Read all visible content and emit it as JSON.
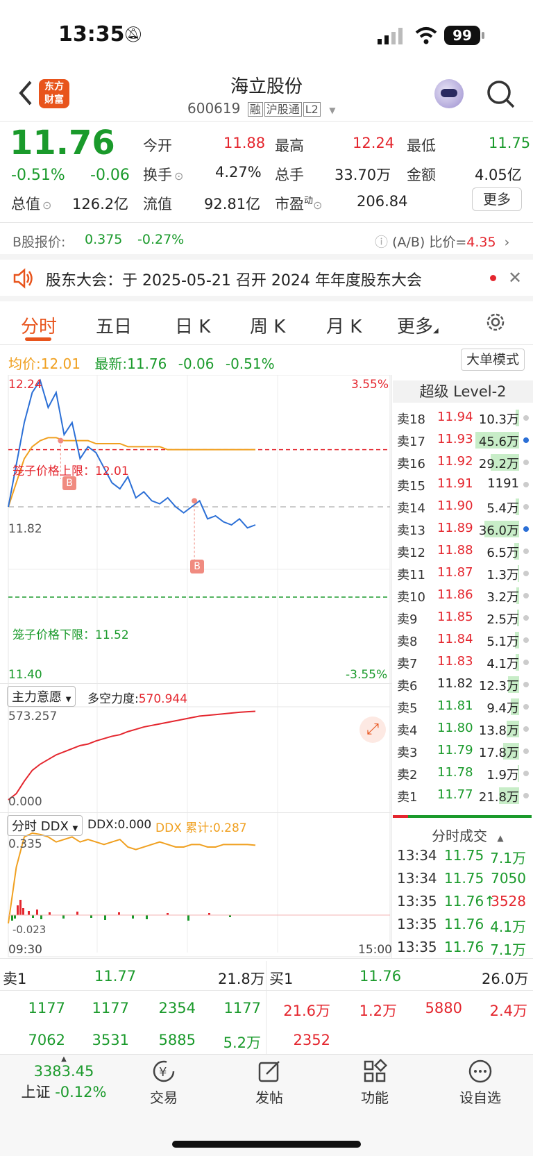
{
  "status": {
    "time": "13:35",
    "battery": "99"
  },
  "header": {
    "title": "海立股份",
    "code": "600619",
    "badges": [
      "融",
      "沪股通",
      "L2"
    ],
    "logo_line1": "东方",
    "logo_line2": "财富"
  },
  "quote": {
    "price": "11.76",
    "pct": "-0.51%",
    "chg": "-0.06",
    "open_label": "今开",
    "open": "11.88",
    "high_label": "最高",
    "high": "12.24",
    "low_label": "最低",
    "low": "11.75",
    "turnover_label": "换手",
    "turnover": "4.27%",
    "volume_label": "总手",
    "volume": "33.70万",
    "amount_label": "金额",
    "amount": "4.05亿",
    "mcap_label": "总值",
    "mcap": "126.2亿",
    "float_label": "流值",
    "float": "92.81亿",
    "pe_label": "市盈",
    "pe_sup": "动",
    "pe": "206.84",
    "more": "更多"
  },
  "bshare": {
    "label": "B股报价:",
    "price": "0.375",
    "pct": "-0.27%",
    "ratio_label": "(A/B) 比价=",
    "ratio": "4.35"
  },
  "notice": {
    "text": "股东大会：于 2025-05-21 召开 2024 年年度股东大会"
  },
  "tabs": [
    "分时",
    "五日",
    "日 K",
    "周 K",
    "月 K",
    "更多"
  ],
  "avg_line": {
    "avg_label": "均价:",
    "avg": "12.01",
    "latest_label": "最新:",
    "latest": "11.76",
    "chg": "-0.06",
    "pct": "-0.51%",
    "mode_btn": "大单模式"
  },
  "chart": {
    "top_price": "12.24",
    "top_pct": "3.55%",
    "mid_price": "11.82",
    "bottom_price": "11.40",
    "bottom_pct": "-3.55%",
    "upper_limit": "笼子价格上限：12.01",
    "lower_limit": "笼子价格下限：11.52",
    "marker": "B",
    "ind1_name": "主力意愿",
    "ind1_label": "多空力度:",
    "ind1_value": "570.944",
    "ind1_max": "573.257",
    "ind1_min": "0.000",
    "ind2_name": "分时 DDX",
    "ind2_ddx": "DDX:0.000",
    "ind2_cum": "DDX 累计:0.287",
    "ind2_max": "0.335",
    "ind2_min": "-0.023",
    "time_start": "09:30",
    "time_end": "15:00"
  },
  "chart_data": {
    "type": "line",
    "ylim": [
      11.4,
      12.24
    ],
    "open": 11.82,
    "upper_limit": 12.01,
    "lower_limit": 11.52,
    "price": [
      11.82,
      11.96,
      12.1,
      12.2,
      12.24,
      12.15,
      12.2,
      12.06,
      12.1,
      11.98,
      12.02,
      12.0,
      11.95,
      11.9,
      11.88,
      11.92,
      11.85,
      11.87,
      11.84,
      11.83,
      11.85,
      11.82,
      11.8,
      11.82,
      11.84,
      11.78,
      11.79,
      11.77,
      11.76,
      11.78,
      11.75,
      11.76
    ],
    "avg": [
      11.82,
      11.9,
      11.98,
      12.02,
      12.04,
      12.05,
      12.05,
      12.04,
      12.04,
      12.04,
      12.04,
      12.03,
      12.03,
      12.03,
      12.03,
      12.02,
      12.02,
      12.02,
      12.02,
      12.02,
      12.01,
      12.01,
      12.01,
      12.01,
      12.01,
      12.01,
      12.01,
      12.01,
      12.01,
      12.01,
      12.01,
      12.01
    ],
    "force": [
      0,
      40,
      120,
      190,
      230,
      260,
      290,
      310,
      330,
      350,
      360,
      380,
      395,
      410,
      420,
      440,
      455,
      470,
      480,
      490,
      500,
      510,
      520,
      530,
      540,
      545,
      550,
      555,
      560,
      565,
      568,
      570.944
    ],
    "ddx": [
      -0.023,
      0.2,
      0.32,
      0.335,
      0.33,
      0.32,
      0.3,
      0.31,
      0.32,
      0.3,
      0.31,
      0.3,
      0.29,
      0.3,
      0.31,
      0.28,
      0.27,
      0.28,
      0.29,
      0.3,
      0.29,
      0.28,
      0.28,
      0.29,
      0.29,
      0.28,
      0.28,
      0.29,
      0.29,
      0.29,
      0.29,
      0.287
    ]
  },
  "level2": {
    "title": "超级 Level-2",
    "sells": [
      {
        "label": "卖18",
        "price": "11.94",
        "vol": "10.3万",
        "bar": 0.05,
        "color": "#e4262e",
        "dot": "#ccc"
      },
      {
        "label": "卖17",
        "price": "11.93",
        "vol": "45.6万",
        "bar": 0.7,
        "color": "#e4262e",
        "dot": "#2b6fd6"
      },
      {
        "label": "卖16",
        "price": "11.92",
        "vol": "29.2万",
        "bar": 0.45,
        "color": "#e4262e",
        "dot": "#ccc"
      },
      {
        "label": "卖15",
        "price": "11.91",
        "vol": "1191",
        "bar": 0,
        "color": "#e4262e",
        "dot": "#ccc"
      },
      {
        "label": "卖14",
        "price": "11.90",
        "vol": "5.4万",
        "bar": 0.05,
        "color": "#e4262e",
        "dot": "#ccc"
      },
      {
        "label": "卖13",
        "price": "11.89",
        "vol": "36.0万",
        "bar": 0.55,
        "color": "#e4262e",
        "dot": "#2b6fd6"
      },
      {
        "label": "卖12",
        "price": "11.88",
        "vol": "6.5万",
        "bar": 0.08,
        "color": "#e4262e",
        "dot": "#ccc"
      },
      {
        "label": "卖11",
        "price": "11.87",
        "vol": "1.3万",
        "bar": 0.02,
        "color": "#e4262e",
        "dot": "#ccc"
      },
      {
        "label": "卖10",
        "price": "11.86",
        "vol": "3.2万",
        "bar": 0.04,
        "color": "#e4262e",
        "dot": "#ccc"
      },
      {
        "label": "卖9",
        "price": "11.85",
        "vol": "2.5万",
        "bar": 0.03,
        "color": "#e4262e",
        "dot": "#ccc"
      },
      {
        "label": "卖8",
        "price": "11.84",
        "vol": "5.1万",
        "bar": 0.07,
        "color": "#e4262e",
        "dot": "#ccc"
      },
      {
        "label": "卖7",
        "price": "11.83",
        "vol": "4.1万",
        "bar": 0.06,
        "color": "#e4262e",
        "dot": "#ccc"
      },
      {
        "label": "卖6",
        "price": "11.82",
        "vol": "12.3万",
        "bar": 0.18,
        "color": "#222",
        "dot": "#ccc"
      },
      {
        "label": "卖5",
        "price": "11.81",
        "vol": "9.4万",
        "bar": 0.13,
        "color": "#1a9a2b",
        "dot": "#ccc"
      },
      {
        "label": "卖4",
        "price": "11.80",
        "vol": "13.8万",
        "bar": 0.2,
        "color": "#1a9a2b",
        "dot": "#ccc"
      },
      {
        "label": "卖3",
        "price": "11.79",
        "vol": "17.8万",
        "bar": 0.26,
        "color": "#1a9a2b",
        "dot": "#ccc"
      },
      {
        "label": "卖2",
        "price": "11.78",
        "vol": "1.9万",
        "bar": 0.02,
        "color": "#1a9a2b",
        "dot": "#ccc"
      },
      {
        "label": "卖1",
        "price": "11.77",
        "vol": "21.8万",
        "bar": 0.32,
        "color": "#1a9a2b",
        "dot": "#ccc"
      }
    ],
    "trades_title": "分时成交",
    "trades": [
      {
        "time": "13:34",
        "price": "11.75",
        "vol": "7.1万",
        "pc": "#1a9a2b",
        "vc": "#1a9a2b"
      },
      {
        "time": "13:34",
        "price": "11.75",
        "vol": "7050",
        "pc": "#1a9a2b",
        "vc": "#1a9a2b"
      },
      {
        "time": "13:35",
        "price": "11.76↑",
        "vol": "3528",
        "pc": "#1a9a2b",
        "vc": "#e4262e"
      },
      {
        "time": "13:35",
        "price": "11.76",
        "vol": "4.1万",
        "pc": "#1a9a2b",
        "vc": "#1a9a2b"
      },
      {
        "time": "13:35",
        "price": "11.76",
        "vol": "7.1万",
        "pc": "#1a9a2b",
        "vc": "#1a9a2b"
      }
    ]
  },
  "book": {
    "sell1_label": "卖1",
    "sell1_price": "11.77",
    "sell1_vol": "21.8万",
    "buy1_label": "买1",
    "buy1_price": "11.76",
    "buy1_vol": "26.0万",
    "sell_row1": [
      "1177",
      "1177",
      "2354",
      "1177"
    ],
    "sell_row2": [
      "7062",
      "3531",
      "5885",
      "5.2万"
    ],
    "buy_row1": [
      "21.6万",
      "1.2万",
      "5880",
      "2.4万"
    ],
    "buy_row2": [
      "2352"
    ]
  },
  "bottom": {
    "index_value": "3383.45",
    "index_name": "上证",
    "index_pct": "-0.12%",
    "items": [
      {
        "label": "交易"
      },
      {
        "label": "发帖"
      },
      {
        "label": "功能"
      },
      {
        "label": "设自选"
      }
    ]
  }
}
